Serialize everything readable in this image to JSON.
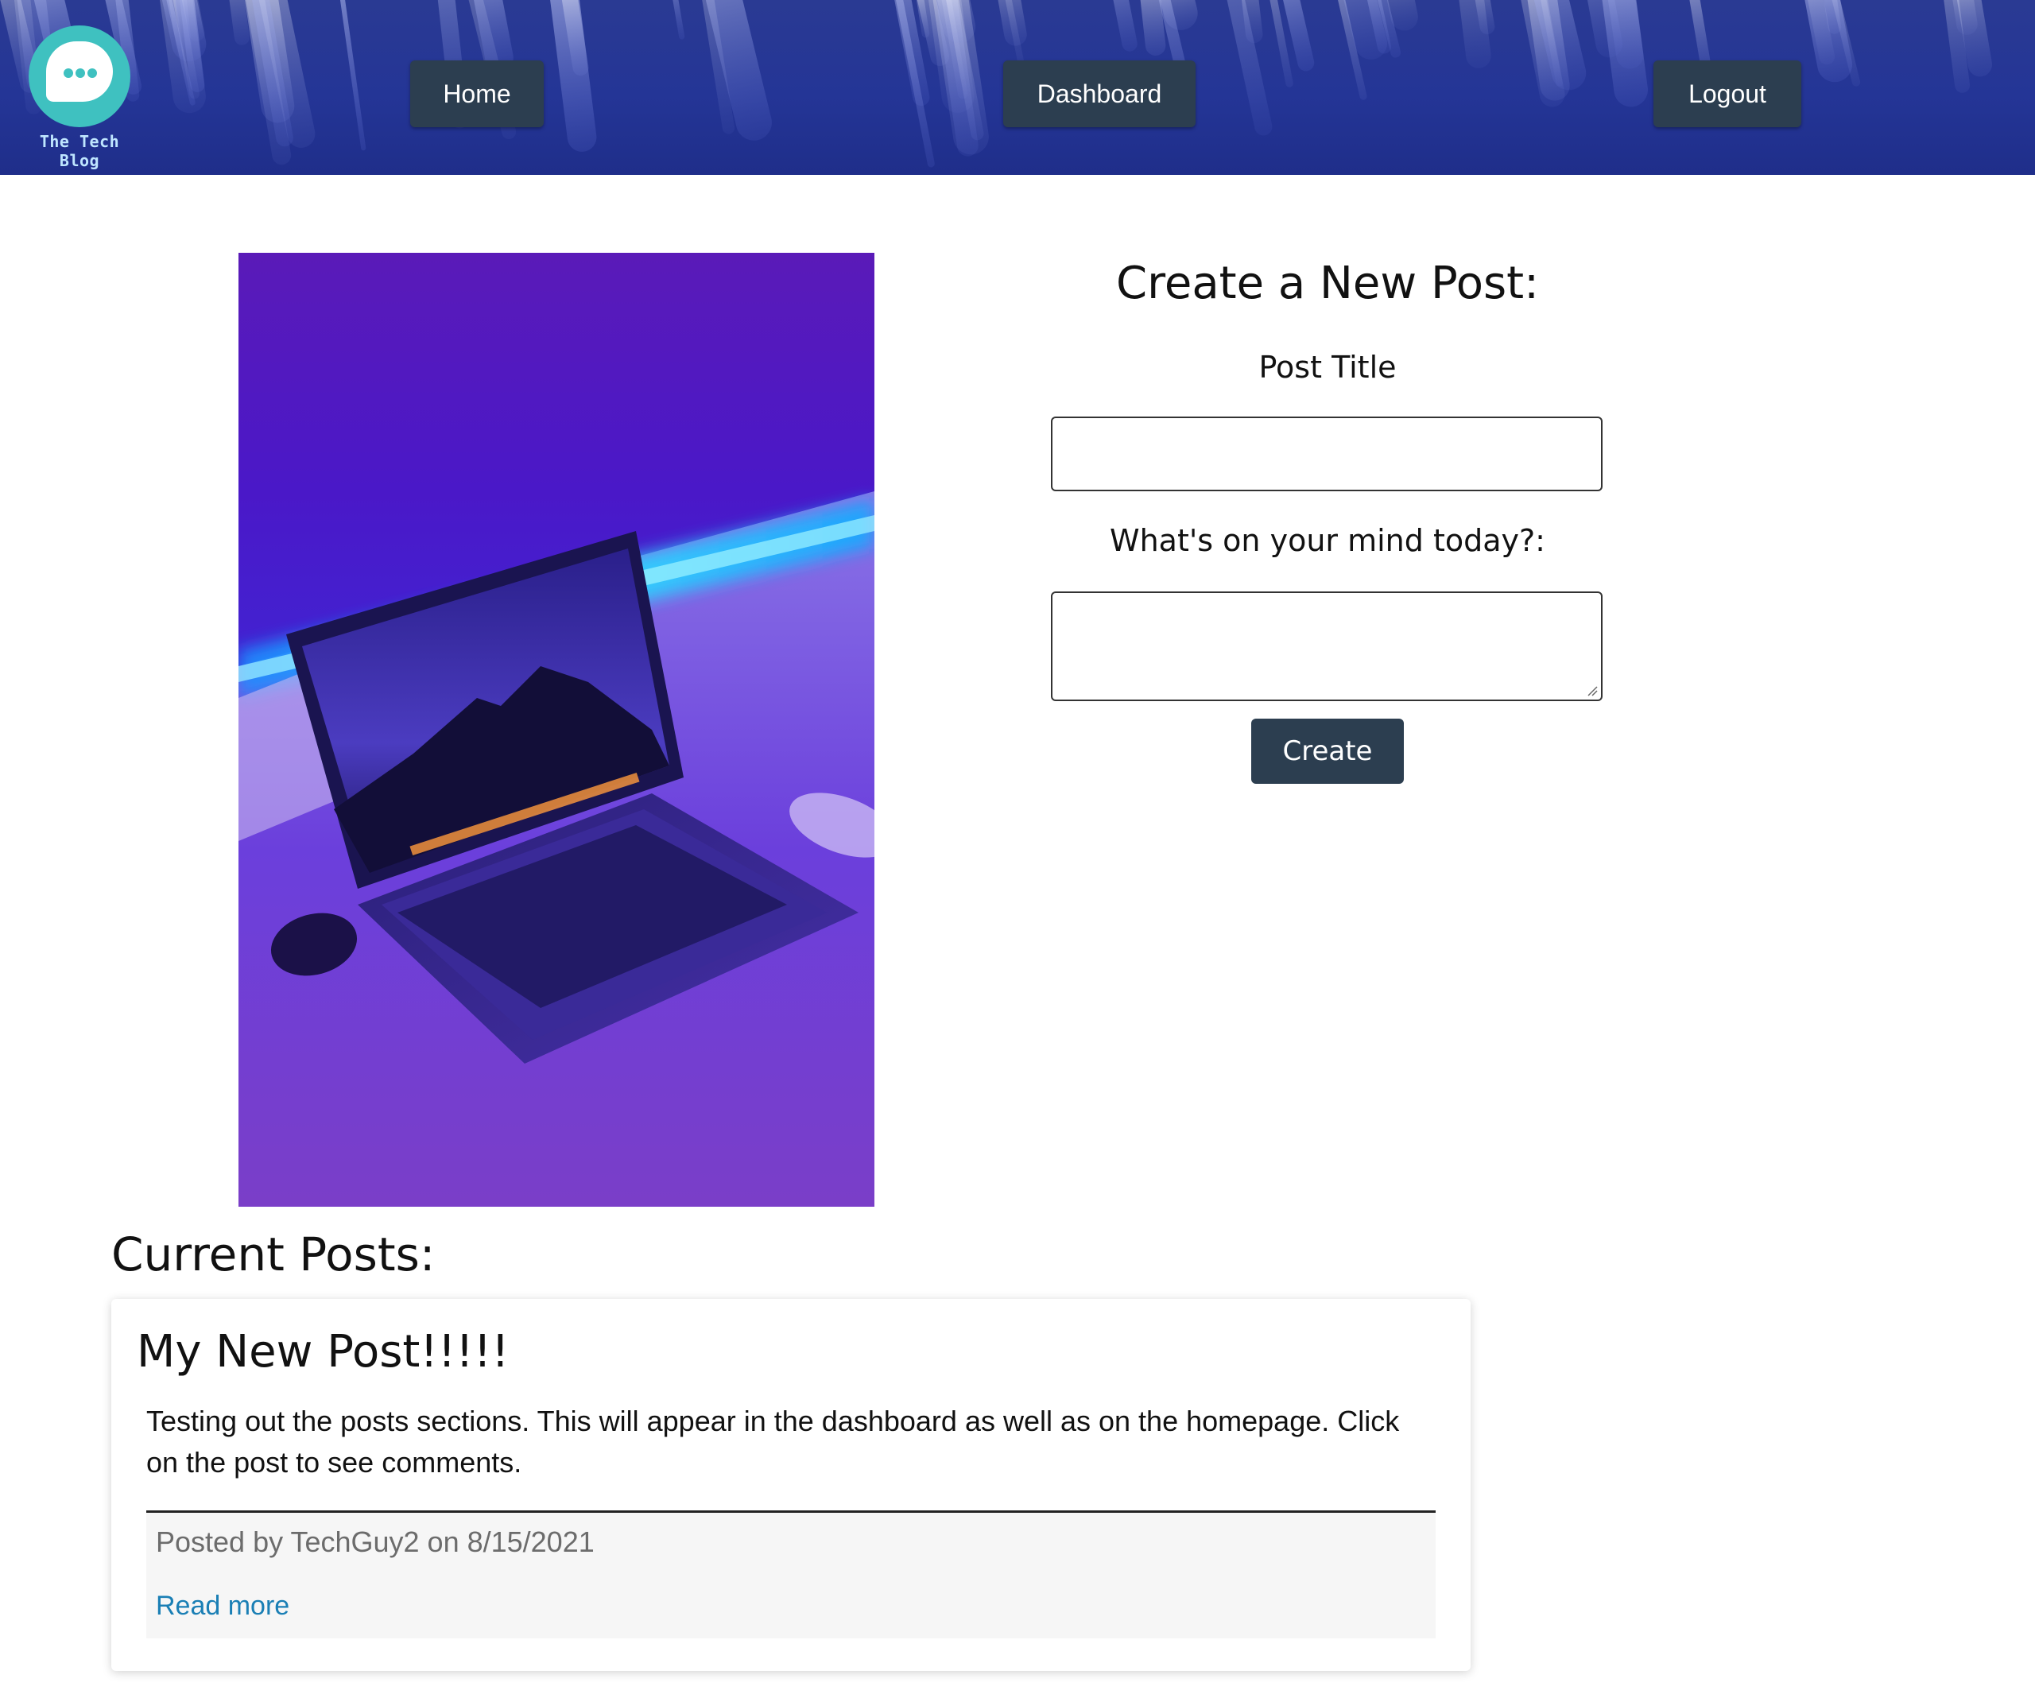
{
  "brand": {
    "logo_text": "The Tech Blog",
    "accent_color": "#3fc1c0"
  },
  "nav": {
    "home_label": "Home",
    "dashboard_label": "Dashboard",
    "logout_label": "Logout",
    "button_color": "#2c3e50"
  },
  "hero": {
    "image_subject": "laptop-purple-light-photo"
  },
  "form": {
    "heading": "Create a New Post:",
    "title_label": "Post Title",
    "title_value": "",
    "body_label": "What's on your mind today?:",
    "body_value": "",
    "submit_label": "Create"
  },
  "posts": {
    "heading": "Current Posts:",
    "items": [
      {
        "title": "My New Post!!!!!",
        "body": "Testing out the posts sections. This will appear in the dashboard as well as on the homepage. Click on the post to see comments.",
        "meta": "Posted by TechGuy2 on 8/15/2021",
        "link_label": "Read more"
      }
    ],
    "link_color": "#1a7fb5"
  }
}
